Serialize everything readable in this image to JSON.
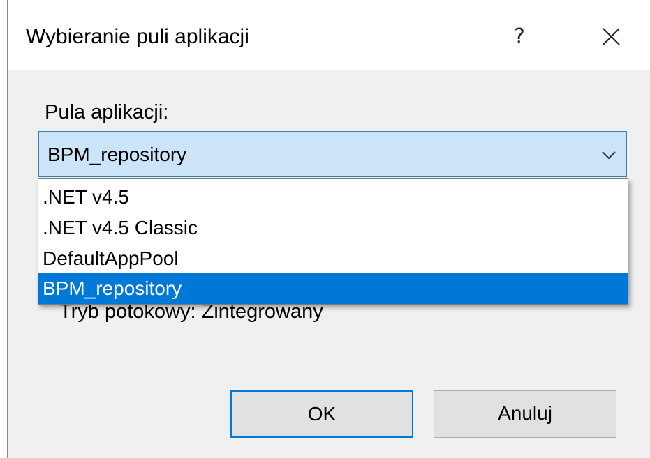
{
  "dialog": {
    "title": "Wybieranie puli aplikacji",
    "help_glyph": "?",
    "close_icon": "close-icon"
  },
  "pool": {
    "label": "Pula aplikacji:",
    "selected": "BPM_repository",
    "options": [
      ".NET v4.5",
      ".NET v4.5 Classic",
      "DefaultAppPool",
      "BPM_repository"
    ],
    "highlighted_option": "BPM_repository"
  },
  "info": {
    "pipeline": "Tryb potokowy: Zintegrowany"
  },
  "buttons": {
    "ok": "OK",
    "cancel": "Anuluj"
  },
  "colors": {
    "accent": "#0078d7",
    "combo_bg": "#cce4f7",
    "dialog_bg": "#f0f0f0"
  }
}
